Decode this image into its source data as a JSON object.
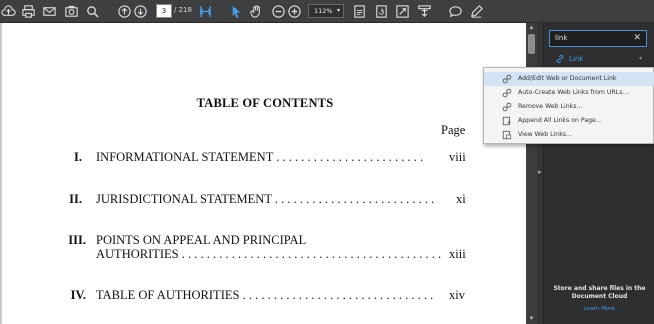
{
  "toolbar": {
    "page_current": "3",
    "page_total": "/ 218",
    "zoom": "112%",
    "icons": [
      "cloud-upload-icon",
      "print-icon",
      "email-icon",
      "screenshot-icon",
      "search-icon",
      "prev-page-icon",
      "next-page-icon",
      "fit-page-icon",
      "select-cursor-icon",
      "hand-tool-icon",
      "zoom-out-icon",
      "zoom-in-icon",
      "zoom-dropdown-icon",
      "fit-width-icon",
      "rotate-icon",
      "fullscreen-icon",
      "scroll-icon",
      "comment-icon",
      "highlight-pen-icon"
    ]
  },
  "document": {
    "title": "TABLE OF CONTENTS",
    "page_header": "Page",
    "toc": [
      {
        "num": "I.",
        "lines": [
          "INFORMATIONAL STATEMENT . . . . . . . . . . . . . . . . . . . . . . . ."
        ],
        "page": "viii"
      },
      {
        "num": "II.",
        "lines": [
          "JURISDICTIONAL STATEMENT  . . . . . . . . . . . . . . . . . . . . . . . . . ."
        ],
        "page": "xi"
      },
      {
        "num": "III.",
        "lines": [
          "POINTS ON APPEAL AND PRINCIPAL",
          "AUTHORITIES . . . . . . . . . . . . . . . . . . . . . . . . . . . . . . . . . . . . . . . . . ."
        ],
        "page": "xiii"
      },
      {
        "num": "IV.",
        "lines": [
          "TABLE OF AUTHORITIES . . . . . . . . . . . . . . . . . . . . . . . . . . . . . . ."
        ],
        "page": "xiv"
      }
    ]
  },
  "right_pane": {
    "search_value": "link",
    "section_label": "Link",
    "promo_title": "Store and share files in the Document Cloud",
    "promo_link": "Learn More"
  },
  "menu": {
    "items": [
      {
        "label": "Add/Edit Web or Document Link",
        "selected": true,
        "icon": "link-edit-icon"
      },
      {
        "label": "Auto-Create Web Links from URLs...",
        "selected": false,
        "icon": "auto-link-icon"
      },
      {
        "label": "Remove Web Links...",
        "selected": false,
        "icon": "remove-link-icon"
      },
      {
        "label": "Append All Links on Page...",
        "selected": false,
        "icon": "append-links-icon"
      },
      {
        "label": "View Web Links...",
        "selected": false,
        "icon": "view-links-icon"
      }
    ]
  },
  "colors": {
    "accent": "#4a9be8",
    "toolbar_bg": "#3d3f41",
    "menu_selected": "#d4e3f3"
  }
}
